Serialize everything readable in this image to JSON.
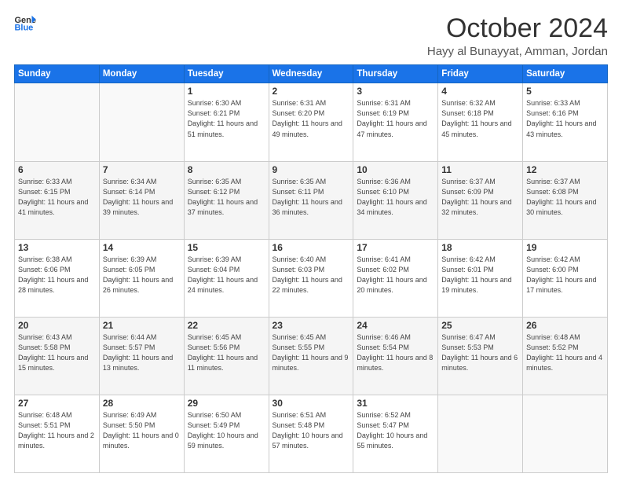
{
  "header": {
    "logo_general": "General",
    "logo_blue": "Blue",
    "month": "October 2024",
    "location": "Hayy al Bunayyat, Amman, Jordan"
  },
  "days_of_week": [
    "Sunday",
    "Monday",
    "Tuesday",
    "Wednesday",
    "Thursday",
    "Friday",
    "Saturday"
  ],
  "weeks": [
    [
      {
        "day": "",
        "info": ""
      },
      {
        "day": "",
        "info": ""
      },
      {
        "day": "1",
        "info": "Sunrise: 6:30 AM\nSunset: 6:21 PM\nDaylight: 11 hours and 51 minutes."
      },
      {
        "day": "2",
        "info": "Sunrise: 6:31 AM\nSunset: 6:20 PM\nDaylight: 11 hours and 49 minutes."
      },
      {
        "day": "3",
        "info": "Sunrise: 6:31 AM\nSunset: 6:19 PM\nDaylight: 11 hours and 47 minutes."
      },
      {
        "day": "4",
        "info": "Sunrise: 6:32 AM\nSunset: 6:18 PM\nDaylight: 11 hours and 45 minutes."
      },
      {
        "day": "5",
        "info": "Sunrise: 6:33 AM\nSunset: 6:16 PM\nDaylight: 11 hours and 43 minutes."
      }
    ],
    [
      {
        "day": "6",
        "info": "Sunrise: 6:33 AM\nSunset: 6:15 PM\nDaylight: 11 hours and 41 minutes."
      },
      {
        "day": "7",
        "info": "Sunrise: 6:34 AM\nSunset: 6:14 PM\nDaylight: 11 hours and 39 minutes."
      },
      {
        "day": "8",
        "info": "Sunrise: 6:35 AM\nSunset: 6:12 PM\nDaylight: 11 hours and 37 minutes."
      },
      {
        "day": "9",
        "info": "Sunrise: 6:35 AM\nSunset: 6:11 PM\nDaylight: 11 hours and 36 minutes."
      },
      {
        "day": "10",
        "info": "Sunrise: 6:36 AM\nSunset: 6:10 PM\nDaylight: 11 hours and 34 minutes."
      },
      {
        "day": "11",
        "info": "Sunrise: 6:37 AM\nSunset: 6:09 PM\nDaylight: 11 hours and 32 minutes."
      },
      {
        "day": "12",
        "info": "Sunrise: 6:37 AM\nSunset: 6:08 PM\nDaylight: 11 hours and 30 minutes."
      }
    ],
    [
      {
        "day": "13",
        "info": "Sunrise: 6:38 AM\nSunset: 6:06 PM\nDaylight: 11 hours and 28 minutes."
      },
      {
        "day": "14",
        "info": "Sunrise: 6:39 AM\nSunset: 6:05 PM\nDaylight: 11 hours and 26 minutes."
      },
      {
        "day": "15",
        "info": "Sunrise: 6:39 AM\nSunset: 6:04 PM\nDaylight: 11 hours and 24 minutes."
      },
      {
        "day": "16",
        "info": "Sunrise: 6:40 AM\nSunset: 6:03 PM\nDaylight: 11 hours and 22 minutes."
      },
      {
        "day": "17",
        "info": "Sunrise: 6:41 AM\nSunset: 6:02 PM\nDaylight: 11 hours and 20 minutes."
      },
      {
        "day": "18",
        "info": "Sunrise: 6:42 AM\nSunset: 6:01 PM\nDaylight: 11 hours and 19 minutes."
      },
      {
        "day": "19",
        "info": "Sunrise: 6:42 AM\nSunset: 6:00 PM\nDaylight: 11 hours and 17 minutes."
      }
    ],
    [
      {
        "day": "20",
        "info": "Sunrise: 6:43 AM\nSunset: 5:58 PM\nDaylight: 11 hours and 15 minutes."
      },
      {
        "day": "21",
        "info": "Sunrise: 6:44 AM\nSunset: 5:57 PM\nDaylight: 11 hours and 13 minutes."
      },
      {
        "day": "22",
        "info": "Sunrise: 6:45 AM\nSunset: 5:56 PM\nDaylight: 11 hours and 11 minutes."
      },
      {
        "day": "23",
        "info": "Sunrise: 6:45 AM\nSunset: 5:55 PM\nDaylight: 11 hours and 9 minutes."
      },
      {
        "day": "24",
        "info": "Sunrise: 6:46 AM\nSunset: 5:54 PM\nDaylight: 11 hours and 8 minutes."
      },
      {
        "day": "25",
        "info": "Sunrise: 6:47 AM\nSunset: 5:53 PM\nDaylight: 11 hours and 6 minutes."
      },
      {
        "day": "26",
        "info": "Sunrise: 6:48 AM\nSunset: 5:52 PM\nDaylight: 11 hours and 4 minutes."
      }
    ],
    [
      {
        "day": "27",
        "info": "Sunrise: 6:48 AM\nSunset: 5:51 PM\nDaylight: 11 hours and 2 minutes."
      },
      {
        "day": "28",
        "info": "Sunrise: 6:49 AM\nSunset: 5:50 PM\nDaylight: 11 hours and 0 minutes."
      },
      {
        "day": "29",
        "info": "Sunrise: 6:50 AM\nSunset: 5:49 PM\nDaylight: 10 hours and 59 minutes."
      },
      {
        "day": "30",
        "info": "Sunrise: 6:51 AM\nSunset: 5:48 PM\nDaylight: 10 hours and 57 minutes."
      },
      {
        "day": "31",
        "info": "Sunrise: 6:52 AM\nSunset: 5:47 PM\nDaylight: 10 hours and 55 minutes."
      },
      {
        "day": "",
        "info": ""
      },
      {
        "day": "",
        "info": ""
      }
    ]
  ]
}
